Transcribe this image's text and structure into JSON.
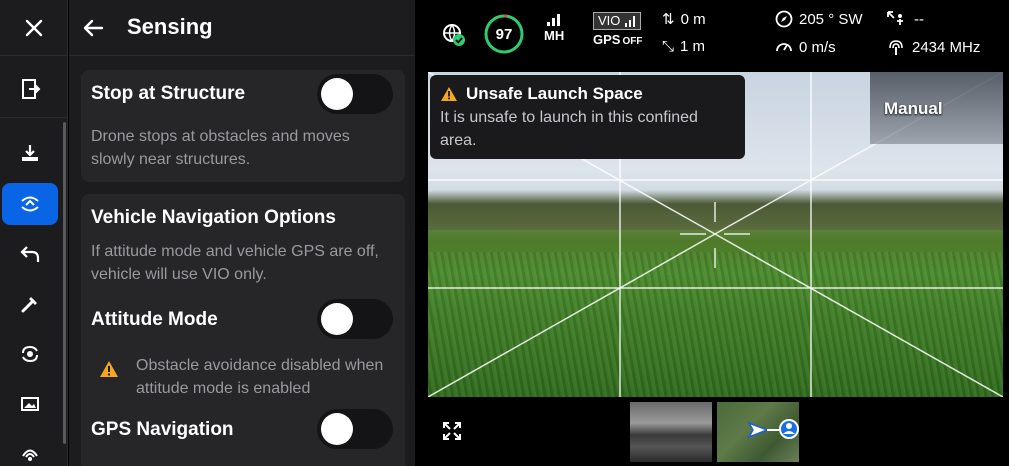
{
  "rail": {
    "items": [
      {
        "name": "close-icon"
      },
      {
        "name": "exit-icon"
      },
      {
        "name": "landing-icon"
      },
      {
        "name": "sensing-icon",
        "active": true
      },
      {
        "name": "return-icon"
      },
      {
        "name": "tools-icon"
      },
      {
        "name": "sync-icon"
      },
      {
        "name": "image-icon"
      },
      {
        "name": "signal-icon"
      }
    ]
  },
  "panel": {
    "title": "Sensing",
    "stop_structure": {
      "title": "Stop at Structure",
      "desc": "Drone stops at obstacles and moves slowly near structures.",
      "enabled": false
    },
    "nav_options": {
      "title": "Vehicle Navigation Options",
      "desc": "If attitude mode and vehicle GPS are off, vehicle will use VIO only."
    },
    "attitude_mode": {
      "title": "Attitude Mode",
      "enabled": false,
      "warning": "Obstacle avoidance disabled when attitude mode is enabled"
    },
    "gps_navigation": {
      "title": "GPS Navigation",
      "enabled": false
    }
  },
  "status": {
    "battery": "97",
    "battery_fraction": 0.97,
    "mh_label": "MH",
    "vio_label": "VIO",
    "gps_label": "GPS",
    "gps_state": "OFF",
    "altitude": "0 m",
    "distance": "1 m",
    "heading": "205 ° SW",
    "speed": "0 m/s",
    "operator": "--",
    "frequency": "2434 MHz"
  },
  "alert": {
    "title": "Unsafe Launch Space",
    "body": "It is unsafe to launch in this confined area."
  },
  "camera": {
    "mode_label": "Manual"
  },
  "colors": {
    "accent": "#0a64e6",
    "warning": "#f5a623",
    "battery_ring": "#2ecc71"
  }
}
